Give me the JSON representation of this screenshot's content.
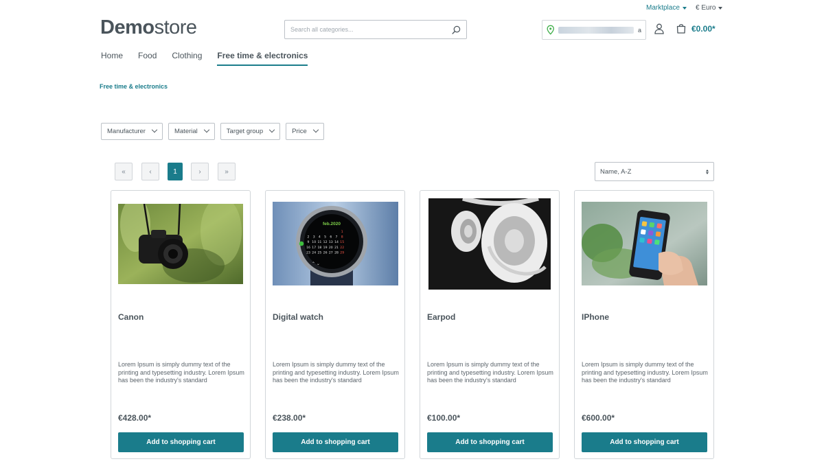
{
  "topbar": {
    "language": "Marktplace",
    "currency": "€ Euro"
  },
  "logo": {
    "bold": "Demo",
    "light": "store"
  },
  "search": {
    "placeholder": "Search all categories..."
  },
  "location": {
    "suffix": "a"
  },
  "cart": {
    "total": "€0.00*"
  },
  "nav": [
    {
      "label": "Home"
    },
    {
      "label": "Food"
    },
    {
      "label": "Clothing"
    },
    {
      "label": "Free time & electronics",
      "active": true
    }
  ],
  "breadcrumb": "Free time & electronics",
  "filters": [
    {
      "label": "Manufacturer"
    },
    {
      "label": "Material"
    },
    {
      "label": "Target group"
    },
    {
      "label": "Price"
    }
  ],
  "pagination": {
    "first": "«",
    "prev": "‹",
    "current": "1",
    "next": "›",
    "last": "»"
  },
  "sort": {
    "selected": "Name, A-Z"
  },
  "products": [
    {
      "name": "Canon",
      "description": "Lorem Ipsum is simply dummy text of the printing and typesetting industry. Lorem Ipsum has been the industry's standard",
      "price": "€428.00*",
      "button": "Add to shopping cart"
    },
    {
      "name": "Digital watch",
      "description": "Lorem Ipsum is simply dummy text of the printing and typesetting industry. Lorem Ipsum has been the industry's standard",
      "price": "€238.00*",
      "button": "Add to shopping cart",
      "watch_date": "feb.2020",
      "watch_days": [
        "1",
        "2",
        "3",
        "4",
        "5",
        "6",
        "7",
        "8",
        "9",
        "10",
        "11",
        "12",
        "13",
        "14",
        "15",
        "16",
        "17",
        "18",
        "19",
        "20",
        "21",
        "22",
        "23",
        "24",
        "25",
        "26",
        "27",
        "28",
        "29"
      ]
    },
    {
      "name": "Earpod",
      "description": "Lorem Ipsum is simply dummy text of the printing and typesetting industry. Lorem Ipsum has been the industry's standard",
      "price": "€100.00*",
      "button": "Add to shopping cart"
    },
    {
      "name": "IPhone",
      "description": "Lorem Ipsum is simply dummy text of the printing and typesetting industry. Lorem Ipsum has been the industry's standard",
      "price": "€600.00*",
      "button": "Add to shopping cart"
    }
  ],
  "colors": {
    "accent": "#1a7c8b",
    "text": "#4a545b",
    "border": "#d1d5d9"
  }
}
